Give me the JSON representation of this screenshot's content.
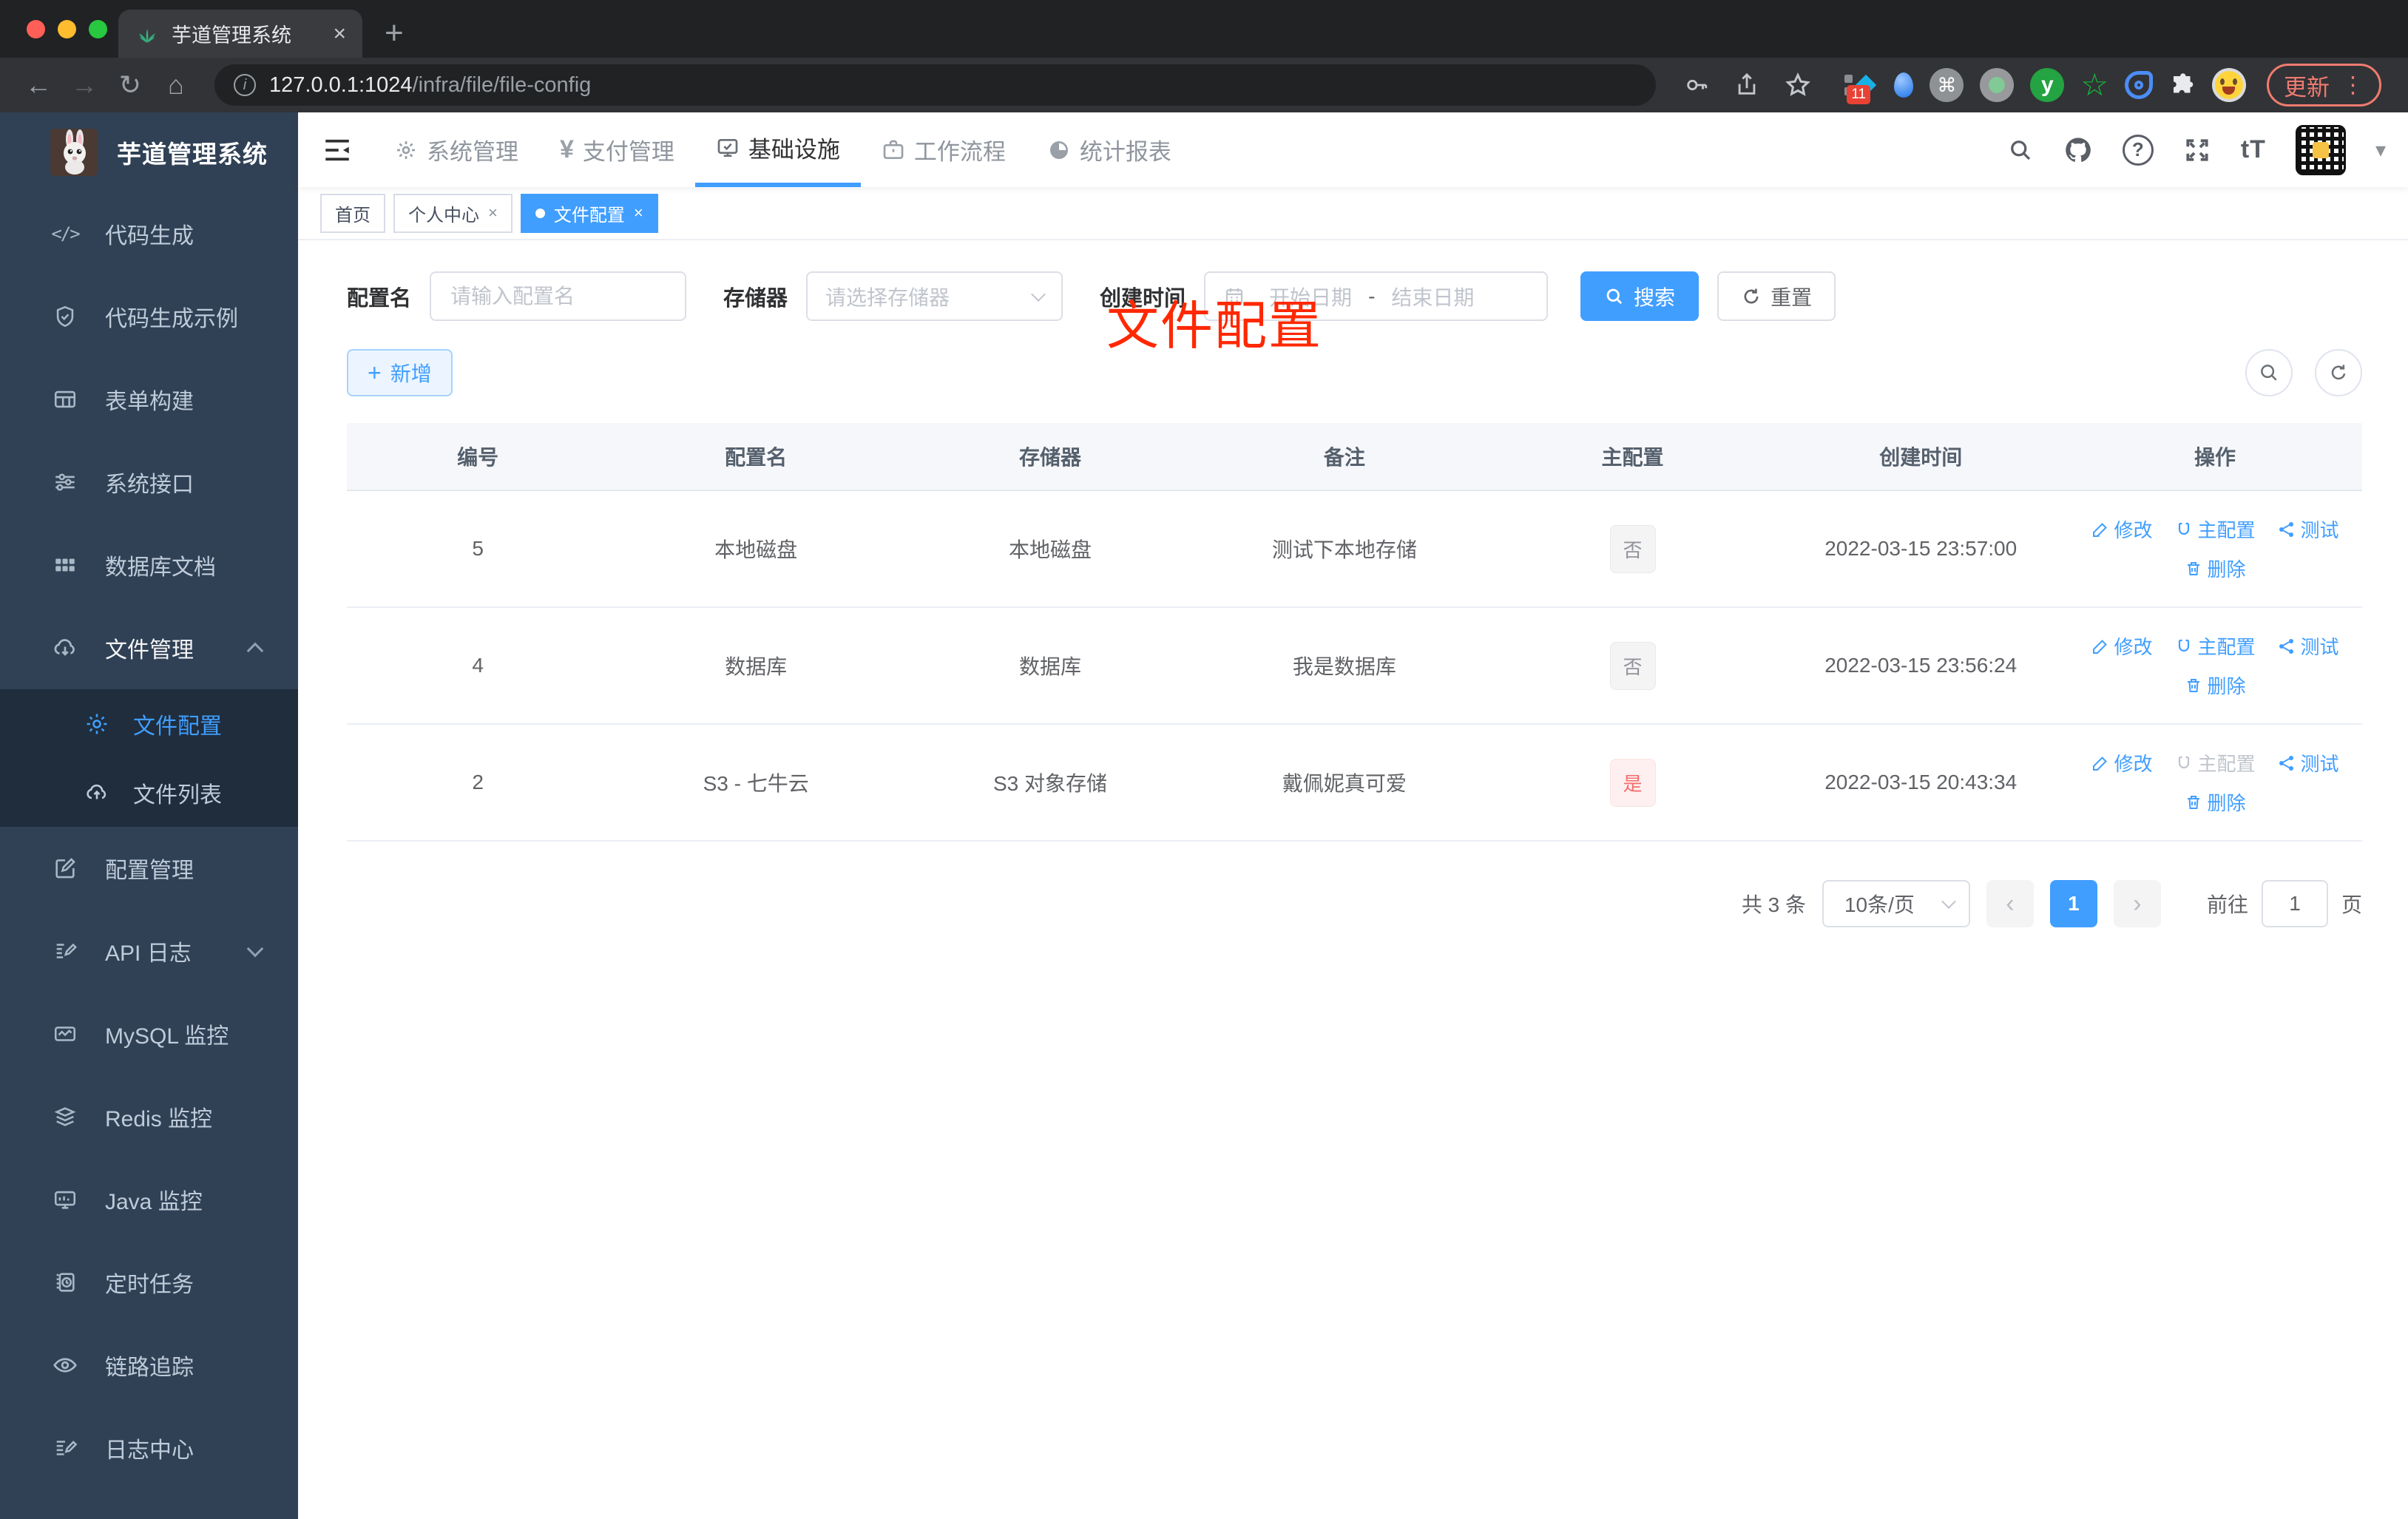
{
  "browser": {
    "tab_title": "芋道管理系统",
    "url_host": "127.0.0.1:1024",
    "url_path": "/infra/file/file-config",
    "extension_badge": "11",
    "update_label": "更新"
  },
  "glyphs": {
    "back": "←",
    "forward": "→",
    "reload": "↻",
    "home": "⌂",
    "tab_close": "×",
    "newtab": "+",
    "info": "i",
    "command": "⌘",
    "green_star": "☆",
    "menu_dots": "⋮",
    "code": "</>",
    "yen": "¥",
    "help": "?",
    "font_size": "tT",
    "caret_down": "▾",
    "plus": "+",
    "close": "×",
    "prev": "‹",
    "next": "›",
    "y_ext": "y"
  },
  "sidebar": {
    "logo_title": "芋道管理系统",
    "menu": [
      {
        "label": "代码生成",
        "icon": "code-icon"
      },
      {
        "label": "代码生成示例",
        "icon": "shield-check-icon"
      },
      {
        "label": "表单构建",
        "icon": "form-grid-icon"
      },
      {
        "label": "系统接口",
        "icon": "sliders-icon"
      },
      {
        "label": "数据库文档",
        "icon": "grid-filled-icon"
      },
      {
        "label": "文件管理",
        "icon": "cloud-download-icon"
      },
      {
        "label": "文件配置",
        "icon": "gear-icon"
      },
      {
        "label": "文件列表",
        "icon": "cloud-upload-icon"
      },
      {
        "label": "配置管理",
        "icon": "edit-square-icon"
      },
      {
        "label": "API 日志",
        "icon": "document-edit-icon"
      },
      {
        "label": "MySQL 监控",
        "icon": "chart-icon"
      },
      {
        "label": "Redis 监控",
        "icon": "layers-icon"
      },
      {
        "label": "Java 监控",
        "icon": "monitor-icon"
      },
      {
        "label": "定时任务",
        "icon": "timer-icon"
      },
      {
        "label": "链路追踪",
        "icon": "eye-icon"
      },
      {
        "label": "日志中心",
        "icon": "log-edit-icon"
      }
    ]
  },
  "topnav": {
    "items": [
      {
        "label": "系统管理",
        "icon": "gear-icon"
      },
      {
        "label": "支付管理",
        "icon": "yen-icon"
      },
      {
        "label": "基础设施",
        "icon": "infra-monitor-icon",
        "active": true
      },
      {
        "label": "工作流程",
        "icon": "briefcase-icon"
      },
      {
        "label": "统计报表",
        "icon": "dashboard-icon"
      }
    ]
  },
  "tags": {
    "items": [
      {
        "label": "首页"
      },
      {
        "label": "个人中心",
        "closable": true
      },
      {
        "label": "文件配置",
        "closable": true,
        "active": true
      }
    ]
  },
  "annotation": {
    "text": "文件配置",
    "color": "#ff2800"
  },
  "filters": {
    "name_label": "配置名",
    "name_placeholder": "请输入配置名",
    "storage_label": "存储器",
    "storage_placeholder": "请选择存储器",
    "time_label": "创建时间",
    "start_placeholder": "开始日期",
    "separator": "-",
    "end_placeholder": "结束日期",
    "search_label": "搜索",
    "reset_label": "重置"
  },
  "toolbar": {
    "add_label": "新增"
  },
  "table": {
    "columns": [
      "编号",
      "配置名",
      "存储器",
      "备注",
      "主配置",
      "创建时间",
      "操作"
    ],
    "actions": {
      "edit": "修改",
      "master": "主配置",
      "test": "测试",
      "delete": "删除"
    },
    "rows": [
      {
        "id": "5",
        "name": "本地磁盘",
        "storage": "本地磁盘",
        "remark": "测试下本地存储",
        "master": "否",
        "time": "2022-03-15 23:57:00"
      },
      {
        "id": "4",
        "name": "数据库",
        "storage": "数据库",
        "remark": "我是数据库",
        "master": "否",
        "time": "2022-03-15 23:56:24"
      },
      {
        "id": "2",
        "name": "S3 - 七牛云",
        "storage": "S3 对象存储",
        "remark": "戴佩妮真可爱",
        "master": "是",
        "time": "2022-03-15 20:43:34"
      }
    ]
  },
  "pagination": {
    "total": "共 3 条",
    "page_size": "10条/页",
    "current_page": "1",
    "goto_label": "前往",
    "goto_value": "1",
    "unit_label": "页"
  },
  "colors": {
    "accent": "#409eff",
    "danger": "#f56c6c",
    "sidebar_bg": "#304156",
    "annotation_red": "#ff2800"
  }
}
